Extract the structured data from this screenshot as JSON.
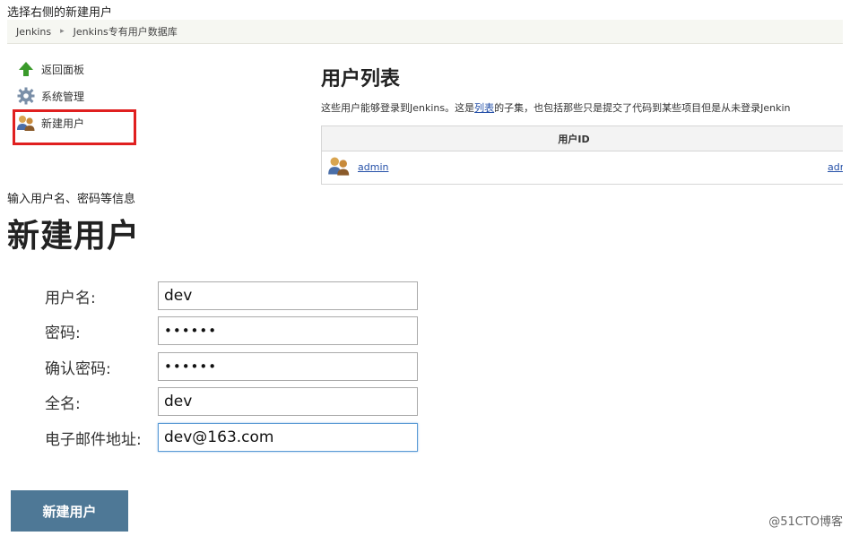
{
  "captions": {
    "step1": "选择右侧的新建用户",
    "step2": "输入用户名、密码等信息"
  },
  "jenkins": {
    "breadcrumb": [
      "Jenkins",
      "Jenkins专有用户数据库"
    ],
    "tasks": [
      {
        "label": "返回面板",
        "icon": "up-arrow-icon"
      },
      {
        "label": "系统管理",
        "icon": "gear-icon"
      },
      {
        "label": "新建用户",
        "icon": "users-icon"
      }
    ],
    "page_title": "用户列表",
    "description": {
      "prefix": "这些用户能够登录到Jenkins。这是",
      "link": "列表",
      "suffix": "的子集，也包括那些只是提交了代码到某些项目但是从未登录Jenkin"
    },
    "table": {
      "header": "用户ID",
      "rows": [
        {
          "id": "admin",
          "name_truncated": "adr"
        }
      ]
    }
  },
  "form": {
    "title": "新建用户",
    "fields": [
      {
        "label": "用户名:",
        "value": "dev"
      },
      {
        "label": "密码:",
        "value": "••••••"
      },
      {
        "label": "确认密码:",
        "value": "••••••"
      },
      {
        "label": "全名:",
        "value": "dev"
      },
      {
        "label": "电子邮件地址:",
        "value": "dev@163.com"
      }
    ],
    "submit_label": "新建用户"
  },
  "watermark": "@51CTO博客",
  "colors": {
    "highlight": "#e02020",
    "submit_bg": "#4e7896",
    "link": "#2550a8"
  }
}
